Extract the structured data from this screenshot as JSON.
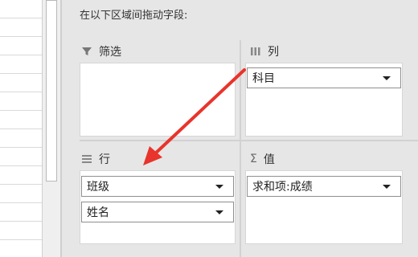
{
  "pivot_panel": {
    "instruction": "在以下区域间拖动字段:",
    "filters": {
      "title": "筛选",
      "icon": "filter-icon",
      "items": []
    },
    "columns": {
      "title": "列",
      "icon": "columns-icon",
      "items": [
        "科目"
      ]
    },
    "rows": {
      "title": "行",
      "icon": "rows-icon",
      "items": [
        "班级",
        "姓名"
      ]
    },
    "values": {
      "title": "值",
      "icon": "sigma-icon",
      "symbol": "Σ",
      "items": [
        "求和项:成绩"
      ]
    }
  },
  "annotation": {
    "arrow_color": "#e8342c"
  }
}
